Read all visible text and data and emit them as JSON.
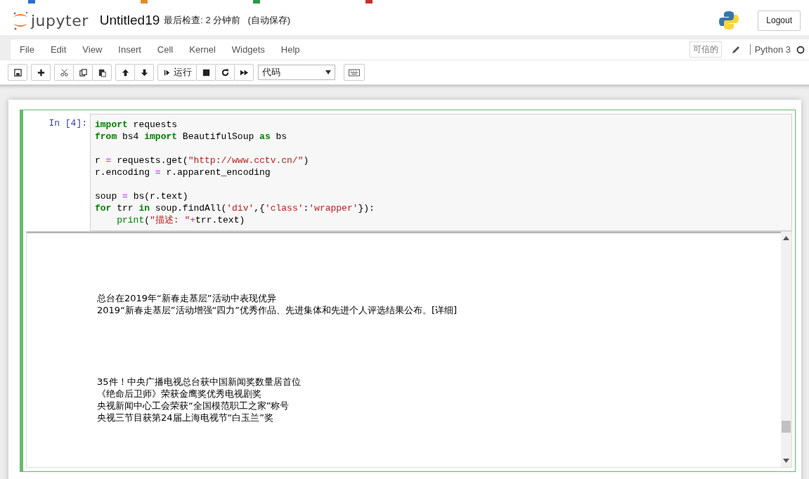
{
  "header": {
    "logo_text": "jupyter",
    "title": "Untitled19",
    "checkpoint": "最后检查: 2 分钟前",
    "autosave": "(自动保存)",
    "logout": "Logout"
  },
  "menu": {
    "items": [
      "File",
      "Edit",
      "View",
      "Insert",
      "Cell",
      "Kernel",
      "Widgets",
      "Help"
    ],
    "trusted": "可信的",
    "kernel": "Python 3",
    "kernel_busy": false
  },
  "toolbar": {
    "groups": [
      [
        {
          "kind": "save"
        }
      ],
      [
        {
          "kind": "add"
        }
      ],
      [
        {
          "kind": "cut"
        },
        {
          "kind": "copy"
        },
        {
          "kind": "paste"
        }
      ],
      [
        {
          "kind": "up"
        },
        {
          "kind": "down"
        }
      ],
      [
        {
          "kind": "run",
          "label": "运行"
        },
        {
          "kind": "stop"
        },
        {
          "kind": "restart"
        },
        {
          "kind": "run-all"
        }
      ]
    ],
    "cell_type": "代码"
  },
  "cell": {
    "selected": true,
    "prompt": "In [4]:",
    "code_blocks": [
      [
        [
          {
            "kind": "kw",
            "t": "import"
          },
          {
            "kind": "p",
            "t": " requests"
          }
        ],
        [
          {
            "kind": "kw",
            "t": "from"
          },
          {
            "kind": "p",
            "t": " bs4 "
          },
          {
            "kind": "kw",
            "t": "import"
          },
          {
            "kind": "p",
            "t": " BeautifulSoup "
          },
          {
            "kind": "kw",
            "t": "as"
          },
          {
            "kind": "p",
            "t": " bs"
          }
        ]
      ],
      [
        [
          {
            "kind": "p",
            "t": "r "
          },
          {
            "kind": "op",
            "t": "="
          },
          {
            "kind": "p",
            "t": " requests.get("
          },
          {
            "kind": "str",
            "t": "\"http://www.cctv.cn/\""
          },
          {
            "kind": "p",
            "t": ")"
          }
        ],
        [
          {
            "kind": "p",
            "t": "r.encoding "
          },
          {
            "kind": "op",
            "t": "="
          },
          {
            "kind": "p",
            "t": " r.apparent_encoding"
          }
        ]
      ],
      [
        [
          {
            "kind": "p",
            "t": "soup "
          },
          {
            "kind": "op",
            "t": "="
          },
          {
            "kind": "p",
            "t": " bs(r.text)"
          }
        ],
        [
          {
            "kind": "kw",
            "t": "for"
          },
          {
            "kind": "p",
            "t": " trr "
          },
          {
            "kind": "kw",
            "t": "in"
          },
          {
            "kind": "p",
            "t": " soup.findAll("
          },
          {
            "kind": "str",
            "t": "'div'"
          },
          {
            "kind": "p",
            "t": ",{"
          },
          {
            "kind": "str",
            "t": "'class'"
          },
          {
            "kind": "p",
            "t": ":"
          },
          {
            "kind": "str",
            "t": "'wrapper'"
          },
          {
            "kind": "p",
            "t": "}):"
          }
        ],
        [
          {
            "kind": "bi",
            "t": "    print"
          },
          {
            "kind": "p",
            "t": "("
          },
          {
            "kind": "str",
            "t": "\"描述: \""
          },
          {
            "kind": "op",
            "t": "+"
          },
          {
            "kind": "p",
            "t": "trr.text)"
          }
        ]
      ]
    ],
    "output_blocks": [
      [
        "总台在2019年“新春走基层”活动中表现优异",
        "2019“新春走基层”活动增强“四力”优秀作品、先进集体和先进个人评选结果公布。[详细]"
      ],
      [
        "35件！中央广播电视总台获中国新闻奖数量居首位",
        "《绝命后卫师》荣获金鹰奖优秀电视剧奖",
        "央视新闻中心工会荣获“全国模范职工之家”称号",
        "央视三节目获第24届上海电视节“白玉兰”奖"
      ]
    ]
  }
}
